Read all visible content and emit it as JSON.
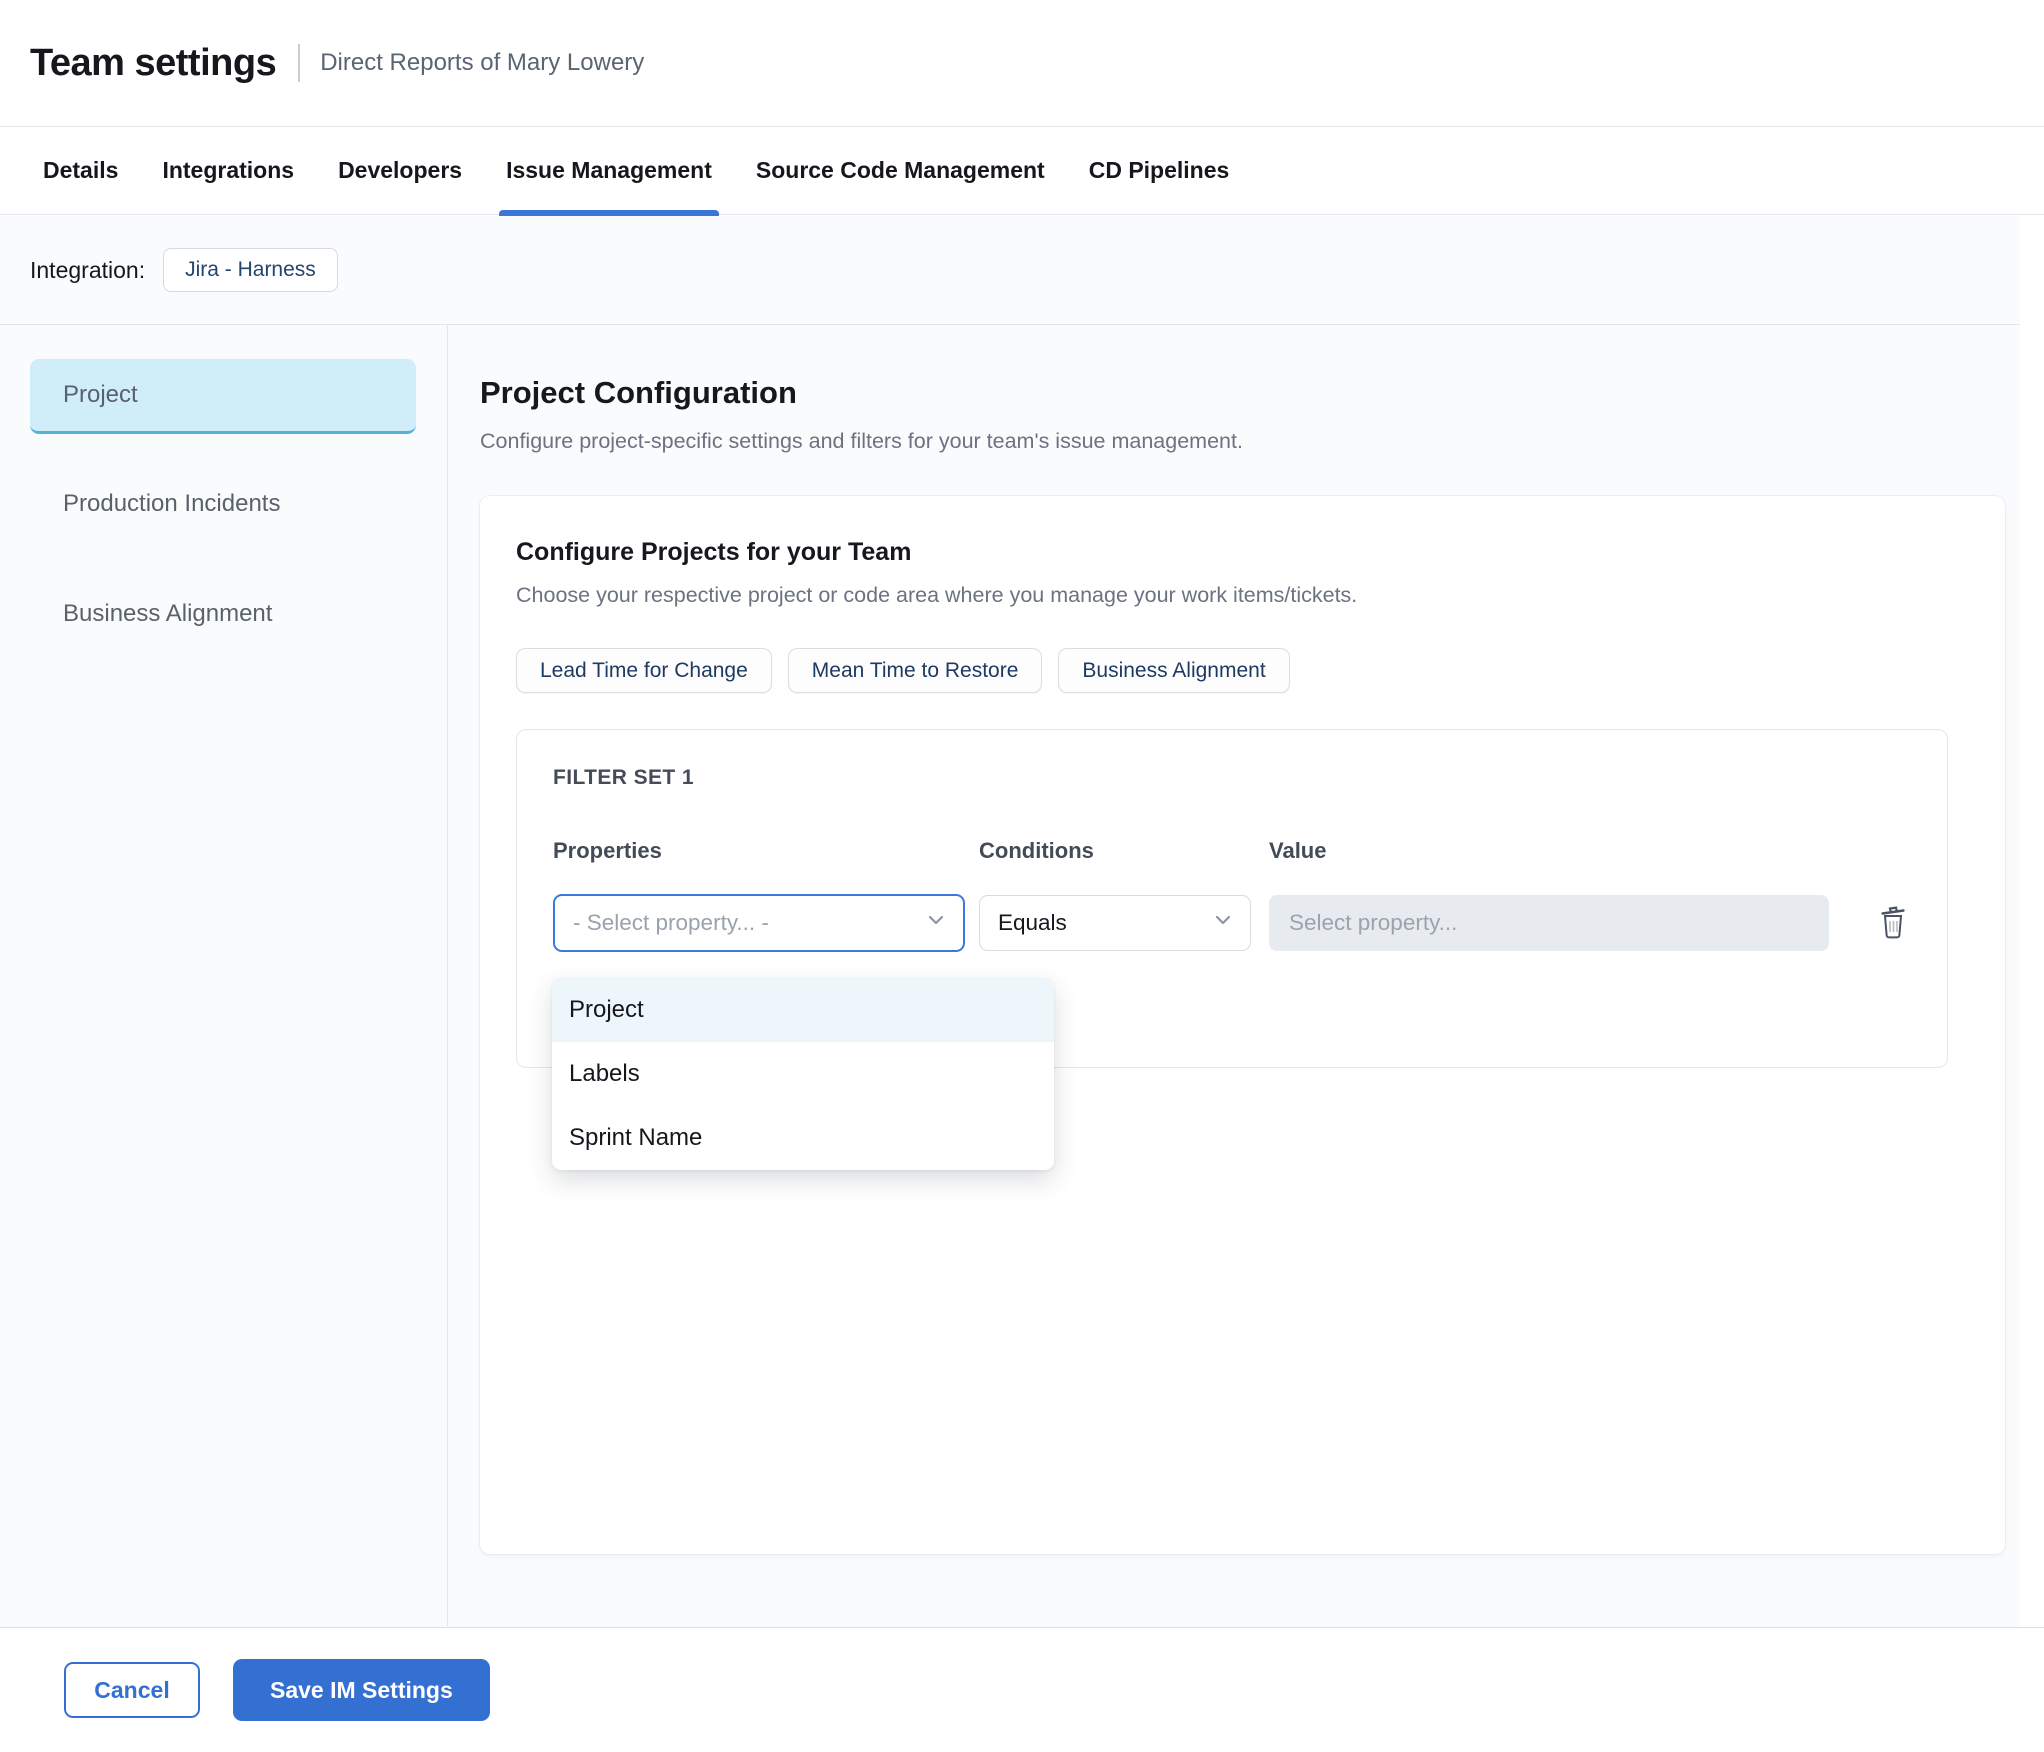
{
  "header": {
    "title": "Team settings",
    "subtitle": "Direct Reports of Mary Lowery"
  },
  "tabs": [
    {
      "label": "Details",
      "active": false
    },
    {
      "label": "Integrations",
      "active": false
    },
    {
      "label": "Developers",
      "active": false
    },
    {
      "label": "Issue Management",
      "active": true
    },
    {
      "label": "Source Code Management",
      "active": false
    },
    {
      "label": "CD Pipelines",
      "active": false
    }
  ],
  "integration": {
    "label": "Integration:",
    "value": "Jira - Harness"
  },
  "sidebar": {
    "items": [
      {
        "label": "Project",
        "selected": true
      },
      {
        "label": "Production Incidents",
        "selected": false
      },
      {
        "label": "Business Alignment",
        "selected": false
      }
    ]
  },
  "main": {
    "title": "Project Configuration",
    "description": "Configure project-specific settings and filters for your team's issue management.",
    "card": {
      "title": "Configure Projects for your Team",
      "description": "Choose your respective project or code area where you manage your work items/tickets.",
      "pills": [
        {
          "label": "Lead Time for Change"
        },
        {
          "label": "Mean Time to Restore"
        },
        {
          "label": "Business Alignment"
        }
      ],
      "filter_set": {
        "title": "FILTER SET 1",
        "columns": {
          "properties": "Properties",
          "conditions": "Conditions",
          "value": "Value"
        },
        "property_select": {
          "value": "- Select property... -"
        },
        "condition_select": {
          "value": "Equals"
        },
        "value_input": {
          "placeholder": "Select property..."
        }
      },
      "dropdown": {
        "options": [
          {
            "label": "Project",
            "highlighted": true
          },
          {
            "label": "Labels",
            "highlighted": false
          },
          {
            "label": "Sprint Name",
            "highlighted": false
          }
        ]
      }
    }
  },
  "footer": {
    "cancel_label": "Cancel",
    "save_label": "Save IM Settings"
  },
  "colors": {
    "accent_blue": "#3470d2",
    "tab_underline": "#3b76d6",
    "selected_sidebar_bg": "#cfeefa",
    "selected_sidebar_border": "#58b0d7",
    "focused_select_border": "#3a79dd",
    "dropdown_highlight": "#edf6fb",
    "chip_text": "#23456e",
    "value_input_bg": "#e7ebef"
  }
}
